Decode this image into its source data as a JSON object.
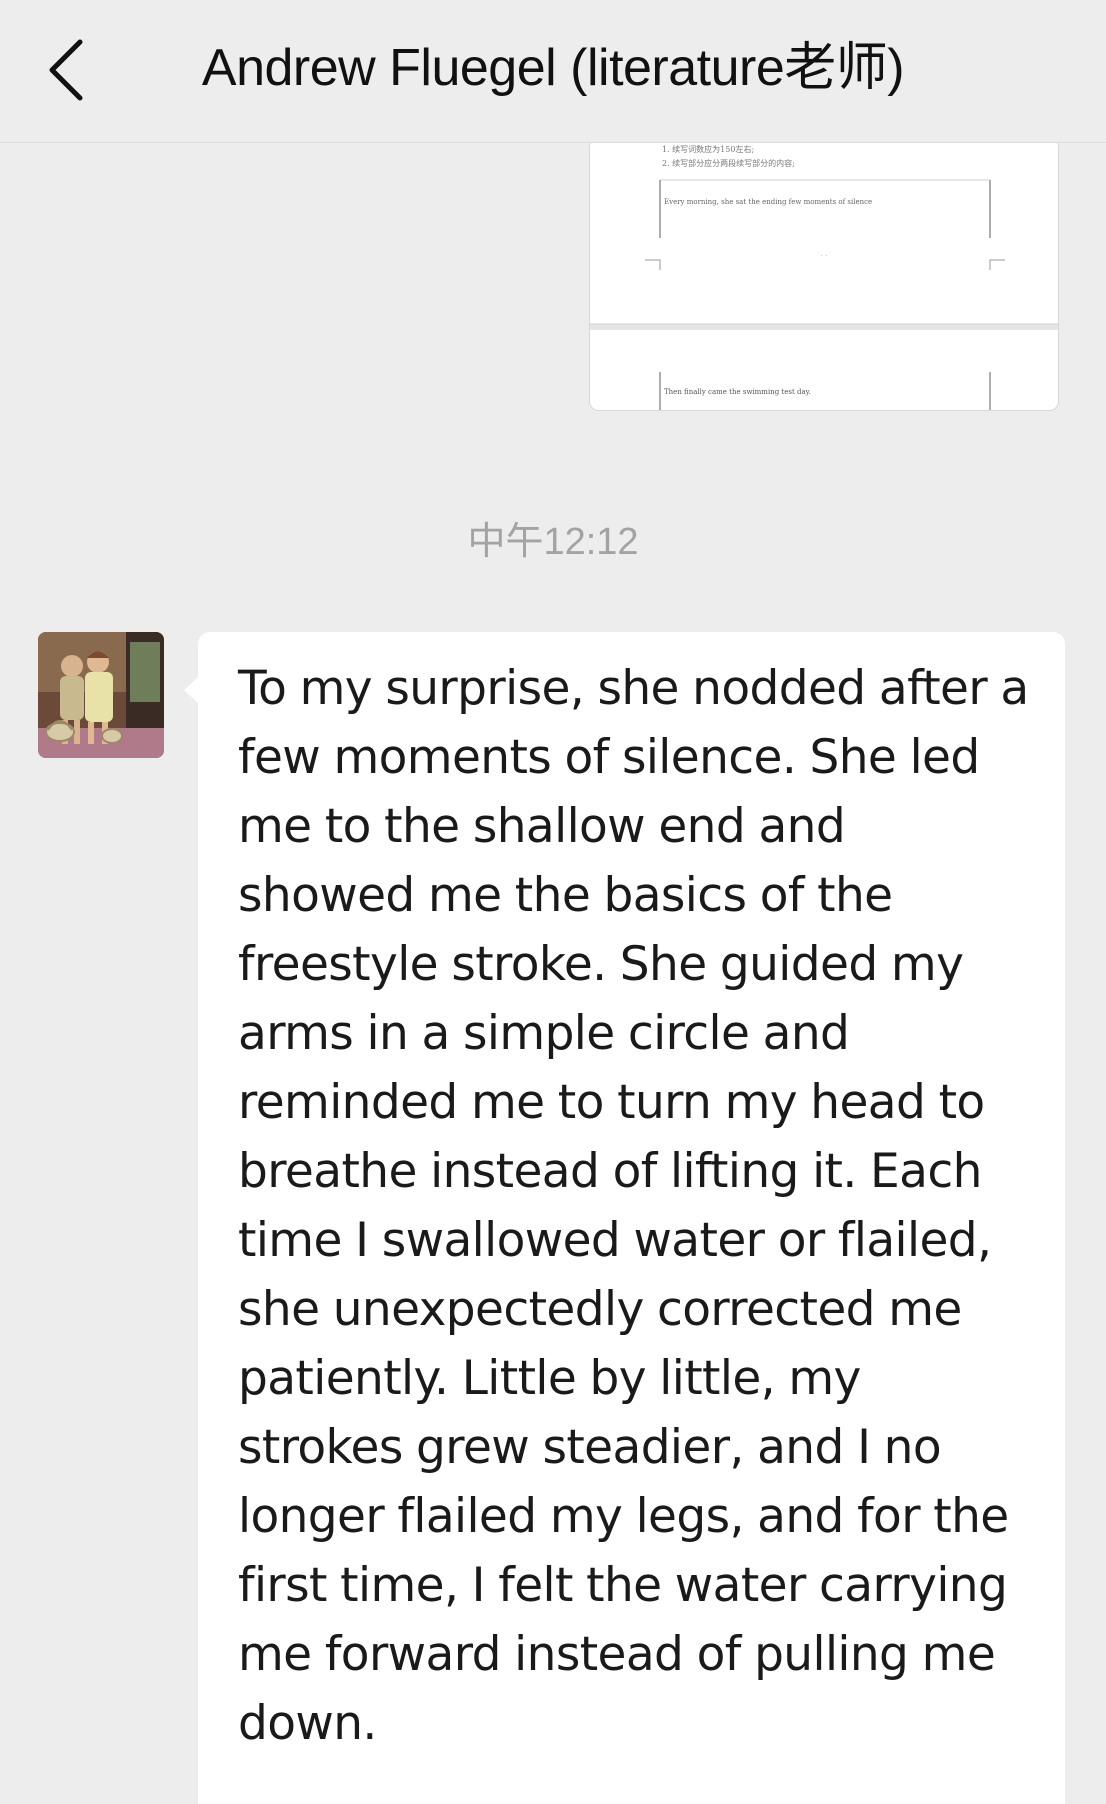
{
  "header": {
    "back_icon": "chevron-left-icon",
    "title": "Andrew Fluegel (literature老师)"
  },
  "messages": {
    "shared_document": {
      "icon": "document-preview",
      "preview_lines": [
        "1. 续写词数应为150左右;",
        "2. 续写部分应分两段续写部分的内容;",
        "Every morning, she sat the ending few moments of silence",
        "Then finally came the swimming test day."
      ]
    },
    "timestamp": "中午12:12",
    "incoming": {
      "avatar_icon": "contact-avatar-photo",
      "text": "To my surprise, she nodded after a few moments of silence. She led me to the shallow end and showed me the basics of the freestyle stroke. She guided my arms in a simple circle and reminded me to turn my head to breathe instead of lifting it. Each time I swallowed water or flailed, she unexpectedly corrected me patiently. Little by little, my strokes grew steadier, and I no longer flailed my legs, and for the first time, I felt the water carrying me forward instead of pulling me down."
    }
  },
  "colors": {
    "background": "#ededed",
    "bubble": "#ffffff",
    "timestamp": "#a3a3a3",
    "text": "#1a1a1a"
  }
}
